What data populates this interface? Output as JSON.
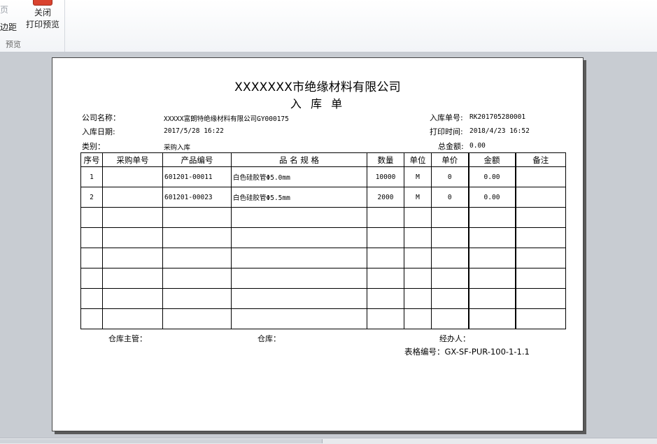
{
  "ribbon": {
    "faded_label": "页",
    "margin_label": "边距",
    "close_line1": "关闭",
    "close_line2": "打印预览",
    "group_label": "预览"
  },
  "document": {
    "title": "XXXXXXX市绝缘材料有限公司",
    "subtitle": "入 库 单",
    "company_label": "公司名称：",
    "company_value": "XXXXX富朗特绝缘材料有限公司GY000175",
    "date_label": "入库日期:",
    "date_value": "2017/5/28 16:22",
    "type_label": "类别：",
    "type_value": "采购入库",
    "order_no_label": "入库单号:",
    "order_no_value": "RK201705280001",
    "print_time_label": "打印时间:",
    "print_time_value": "2018/4/23 16:52",
    "total_label": "总金额:",
    "total_value": "0.00",
    "columns": [
      "序号",
      "采购单号",
      "产品编号",
      "品 名 规 格",
      "数量",
      "单位",
      "单价",
      "金额",
      "备注"
    ],
    "rows": [
      [
        "1",
        "",
        "601201-00011",
        "白色硅胶管Φ5.0mm",
        "10000",
        "M",
        "0",
        "0.00",
        ""
      ],
      [
        "2",
        "",
        "601201-00023",
        "白色硅胶管Φ5.5mm",
        "2000",
        "M",
        "0",
        "0.00",
        ""
      ],
      [
        "",
        "",
        "",
        "",
        "",
        "",
        "",
        "",
        ""
      ],
      [
        "",
        "",
        "",
        "",
        "",
        "",
        "",
        "",
        ""
      ],
      [
        "",
        "",
        "",
        "",
        "",
        "",
        "",
        "",
        ""
      ],
      [
        "",
        "",
        "",
        "",
        "",
        "",
        "",
        "",
        ""
      ],
      [
        "",
        "",
        "",
        "",
        "",
        "",
        "",
        "",
        ""
      ],
      [
        "",
        "",
        "",
        "",
        "",
        "",
        "",
        "",
        ""
      ]
    ],
    "footer": {
      "supervisor_label": "仓库主管：",
      "warehouse_label": "仓库：",
      "handler_label": "经办人：",
      "form_code": "表格编号：GX-SF-PUR-100-1-1.1"
    }
  }
}
